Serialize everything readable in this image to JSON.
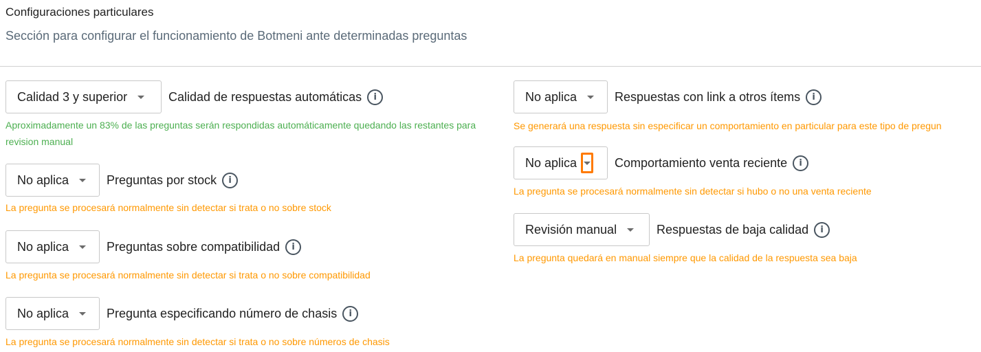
{
  "header": {
    "title": "Configuraciones particulares",
    "subtitle": "Sección para configurar el funcionamiento de Botmeni ante determinadas preguntas"
  },
  "icon": "info-circle-icon",
  "colors": {
    "success": "#4caf50",
    "warning": "#ff9800",
    "highlight": "#ff7a00"
  },
  "settings_left": [
    {
      "select": "Calidad 3 y superior",
      "label": "Calidad de respuestas automáticas",
      "description": "Aproximadamente un 83% de las preguntas serán respondidas automáticamente quedando las restantes para revision manual"
    },
    {
      "select": "No aplica",
      "label": "Preguntas por stock",
      "description": "La pregunta se procesará normalmente sin detectar si trata o no sobre stock"
    },
    {
      "select": "No aplica",
      "label": "Preguntas sobre compatibilidad",
      "description": "La pregunta se procesará normalmente sin detectar si trata o no sobre compatibilidad"
    },
    {
      "select": "No aplica",
      "label": "Pregunta especificando número de chasis",
      "description": "La pregunta se procesará normalmente sin detectar si trata o no sobre números de chasis"
    }
  ],
  "settings_right": [
    {
      "select": "No aplica",
      "label": "Respuestas con link a otros ítems",
      "description": "Se generará una respuesta sin especificar un comportamiento en particular para este tipo de pregun"
    },
    {
      "select": "No aplica",
      "label": "Comportamiento venta reciente",
      "description": "La pregunta se procesará normalmente sin detectar si hubo o no una venta reciente"
    },
    {
      "select": "Revisión manual",
      "label": "Respuestas de baja calidad",
      "description": "La pregunta quedará en manual siempre que la calidad de la respuesta sea baja"
    }
  ]
}
